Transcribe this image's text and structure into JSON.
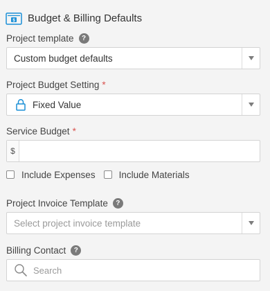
{
  "section": {
    "title": "Budget & Billing Defaults",
    "icon": "invoice-icon"
  },
  "project_template": {
    "label": "Project template",
    "value": "Custom budget defaults"
  },
  "budget_setting": {
    "label": "Project Budget Setting",
    "required_mark": "*",
    "value": "Fixed Value",
    "icon": "lock-icon"
  },
  "service_budget": {
    "label": "Service Budget",
    "required_mark": "*",
    "currency_prefix": "$",
    "value": ""
  },
  "options": {
    "include_expenses": {
      "label": "Include Expenses",
      "checked": false
    },
    "include_materials": {
      "label": "Include Materials",
      "checked": false
    }
  },
  "invoice_template": {
    "label": "Project Invoice Template",
    "placeholder": "Select project invoice template"
  },
  "billing_contact": {
    "label": "Billing Contact",
    "placeholder": "Search"
  },
  "help_glyph": "?",
  "colors": {
    "accent": "#1a8fd6",
    "required": "#d9534f",
    "border": "#d3d3d3"
  }
}
